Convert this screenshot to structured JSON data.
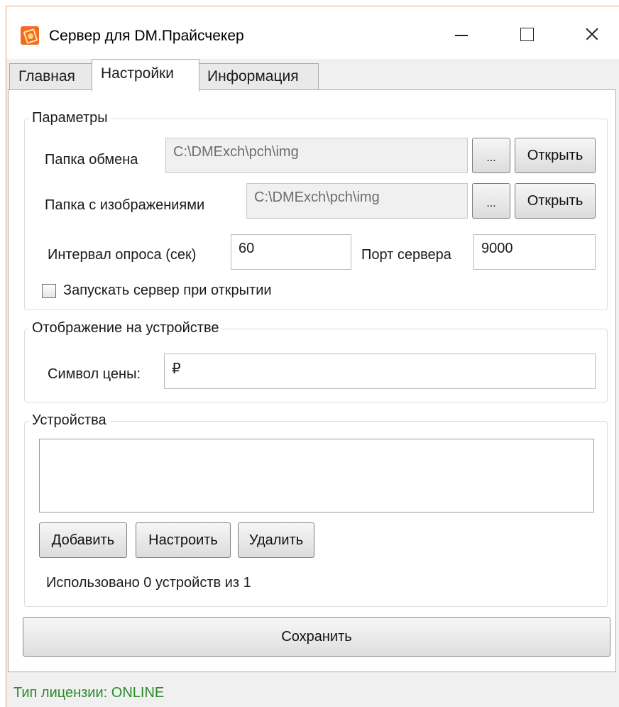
{
  "window": {
    "title": "Сервер для DM.Прайсчекер"
  },
  "tabs": [
    {
      "label": "Главная"
    },
    {
      "label": "Настройки"
    },
    {
      "label": "Информация"
    }
  ],
  "params": {
    "title": "Параметры",
    "exchange_folder_label": "Папка обмена",
    "exchange_folder_value": "C:\\DMExch\\pch\\img",
    "images_folder_label": "Папка с изображениями",
    "images_folder_value": "C:\\DMExch\\pch\\img",
    "browse_label": "...",
    "open_label": "Открыть",
    "poll_interval_label": "Интервал опроса (сек)",
    "poll_interval_value": "60",
    "server_port_label": "Порт сервера",
    "server_port_value": "9000",
    "autostart_label": "Запускать сервер при открытии",
    "autostart_checked": false
  },
  "display": {
    "title": "Отображение на устройстве",
    "price_symbol_label": "Символ цены:",
    "price_symbol_value": "₽"
  },
  "devices": {
    "title": "Устройства",
    "items": [],
    "add_label": "Добавить",
    "configure_label": "Настроить",
    "delete_label": "Удалить",
    "usage_text": "Использовано 0 устройств из 1"
  },
  "save_label": "Сохранить",
  "status": {
    "license_text": "Тип лицензии: ONLINE",
    "license_color": "#2a8a2a"
  },
  "colors": {
    "accent_border": "#e1a35e",
    "app_icon": "#f26b21"
  }
}
